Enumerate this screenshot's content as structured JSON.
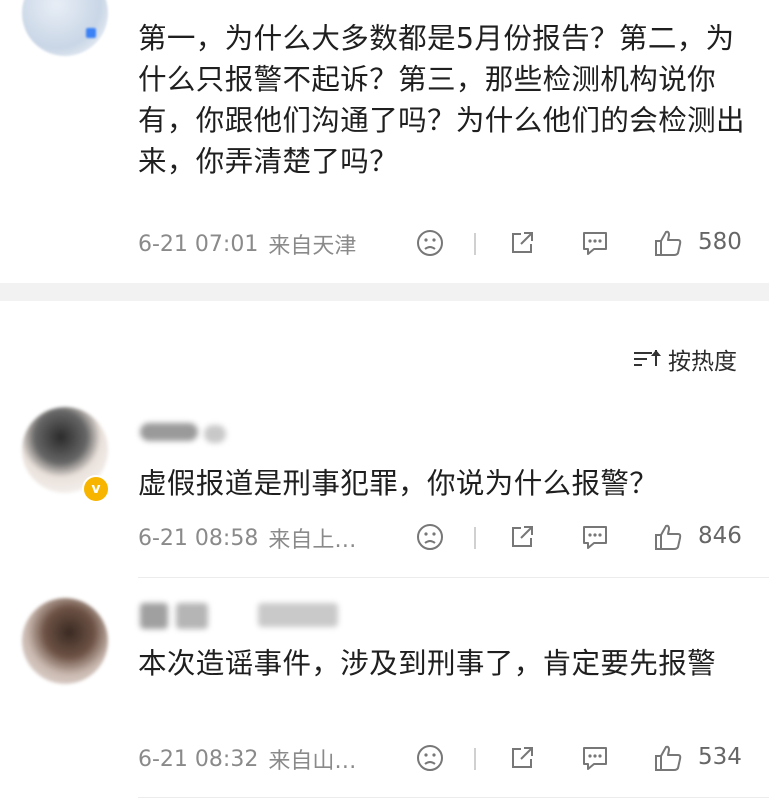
{
  "comments_top": {
    "text": "第一，为什么大多数都是5月份报告？第二，为什么只报警不起诉？第三，那些检测机构说你有，你跟他们沟通了吗？为什么他们的会检测出来，你弄清楚了吗？",
    "time": "6-21 07:01",
    "location": "来自天津",
    "likes": "580"
  },
  "sort": {
    "label": "按热度"
  },
  "comments": [
    {
      "text": "虚假报道是刑事犯罪，你说为什么报警？",
      "time": "6-21 08:58",
      "location": "来自上…",
      "likes": "846"
    },
    {
      "text": "本次造谣事件，涉及到刑事了，肯定要先报警",
      "time": "6-21 08:32",
      "location": "来自山…",
      "likes": "534"
    }
  ],
  "icons": {
    "dislike": "dislike-icon",
    "share": "share-icon",
    "comment": "comment-icon",
    "like": "like-icon",
    "verified": "verified-badge-icon",
    "sort": "sort-icon"
  },
  "colors": {
    "text": "#1f1f1f",
    "meta": "#8a8a8a",
    "divider_band": "#f2f2f2",
    "verified": "#f7b500"
  }
}
